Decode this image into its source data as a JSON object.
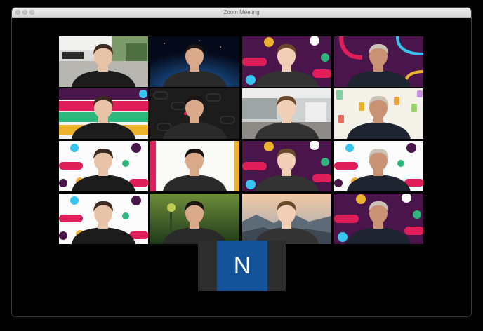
{
  "window": {
    "title": "Zoom Meeting"
  },
  "participants": [
    {
      "bg": "office"
    },
    {
      "bg": "space",
      "active": true
    },
    {
      "bg": "slack"
    },
    {
      "bg": "slack-rings"
    },
    {
      "bg": "stripes"
    },
    {
      "bg": "dark-logo"
    },
    {
      "bg": "office2"
    },
    {
      "bg": "cans"
    },
    {
      "bg": "slack-light"
    },
    {
      "bg": "light-plain"
    },
    {
      "bg": "slack"
    },
    {
      "bg": "slack-light"
    },
    {
      "bg": "slack-light"
    },
    {
      "bg": "forest"
    },
    {
      "bg": "mountains"
    },
    {
      "bg": "slack"
    }
  ],
  "avatar": {
    "initial": "N",
    "color": "#14539a"
  },
  "colors": {
    "slack_purple": "#4a154b",
    "slack_red": "#e01e5a",
    "slack_green": "#2eb67d",
    "slack_yellow": "#ecb22e",
    "slack_blue": "#36c5f0",
    "active_border": "#f4f16a"
  }
}
